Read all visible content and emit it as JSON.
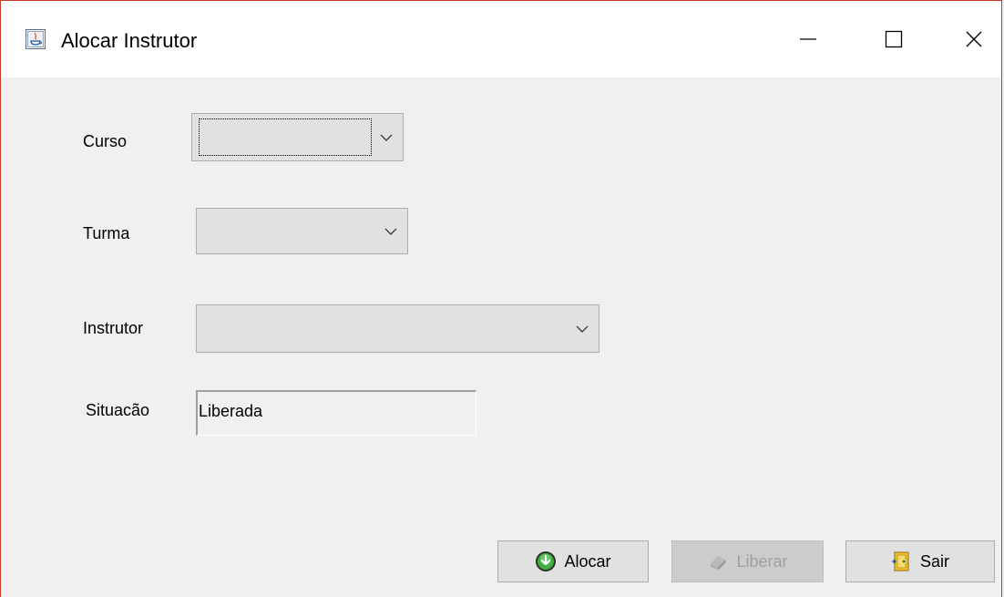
{
  "window": {
    "title": "Alocar Instrutor",
    "app_icon": "java-icon",
    "controls": [
      "minimize-icon",
      "maximize-icon",
      "close-icon"
    ]
  },
  "form": {
    "curso": {
      "label": "Curso",
      "value": ""
    },
    "turma": {
      "label": "Turma",
      "value": ""
    },
    "instrutor": {
      "label": "Instrutor",
      "value": ""
    },
    "situacao": {
      "label": "Situacão",
      "value": "Liberada"
    }
  },
  "buttons": {
    "alocar": {
      "label": "Alocar",
      "icon": "green-download-icon",
      "enabled": true
    },
    "liberar": {
      "label": "Liberar",
      "icon": "eraser-icon",
      "enabled": false
    },
    "sair": {
      "label": "Sair",
      "icon": "exit-door-icon",
      "enabled": true
    }
  },
  "colors": {
    "window_border": "#c83a2a",
    "background": "#f0f0f0",
    "button_face": "#e1e1e1"
  }
}
